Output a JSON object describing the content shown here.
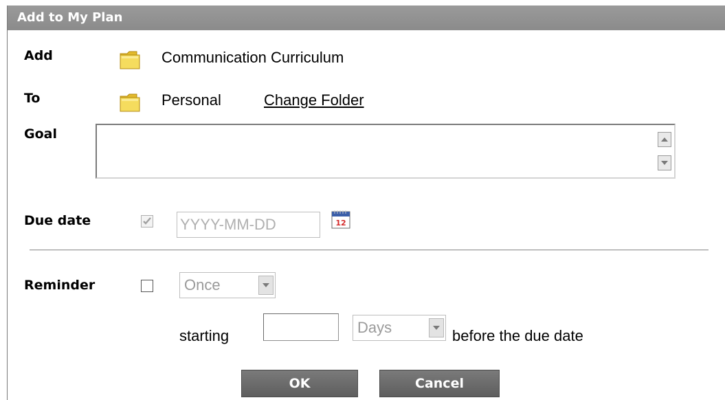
{
  "dialog": {
    "title": "Add to My Plan"
  },
  "add_row": {
    "label": "Add",
    "folder_icon": "folder-icon",
    "value": "Communication Curriculum"
  },
  "to_row": {
    "label": "To",
    "folder_icon": "folder-icon",
    "value": "Personal",
    "change_link": "Change Folder"
  },
  "goal": {
    "label": "Goal",
    "value": ""
  },
  "due_date": {
    "label": "Due date",
    "checked": true,
    "placeholder": "YYYY-MM-DD",
    "calendar_icon": "calendar-icon",
    "calendar_day": "12"
  },
  "reminder": {
    "label": "Reminder",
    "checked": false,
    "frequency": "Once",
    "starting_label": "starting",
    "offset_value": "",
    "unit": "Days",
    "suffix": "before the due date"
  },
  "buttons": {
    "ok": "OK",
    "cancel": "Cancel"
  },
  "colors": {
    "titlebar": "#8b8b8b",
    "button": "#6a6a6a",
    "folder": "#f2d34a"
  }
}
